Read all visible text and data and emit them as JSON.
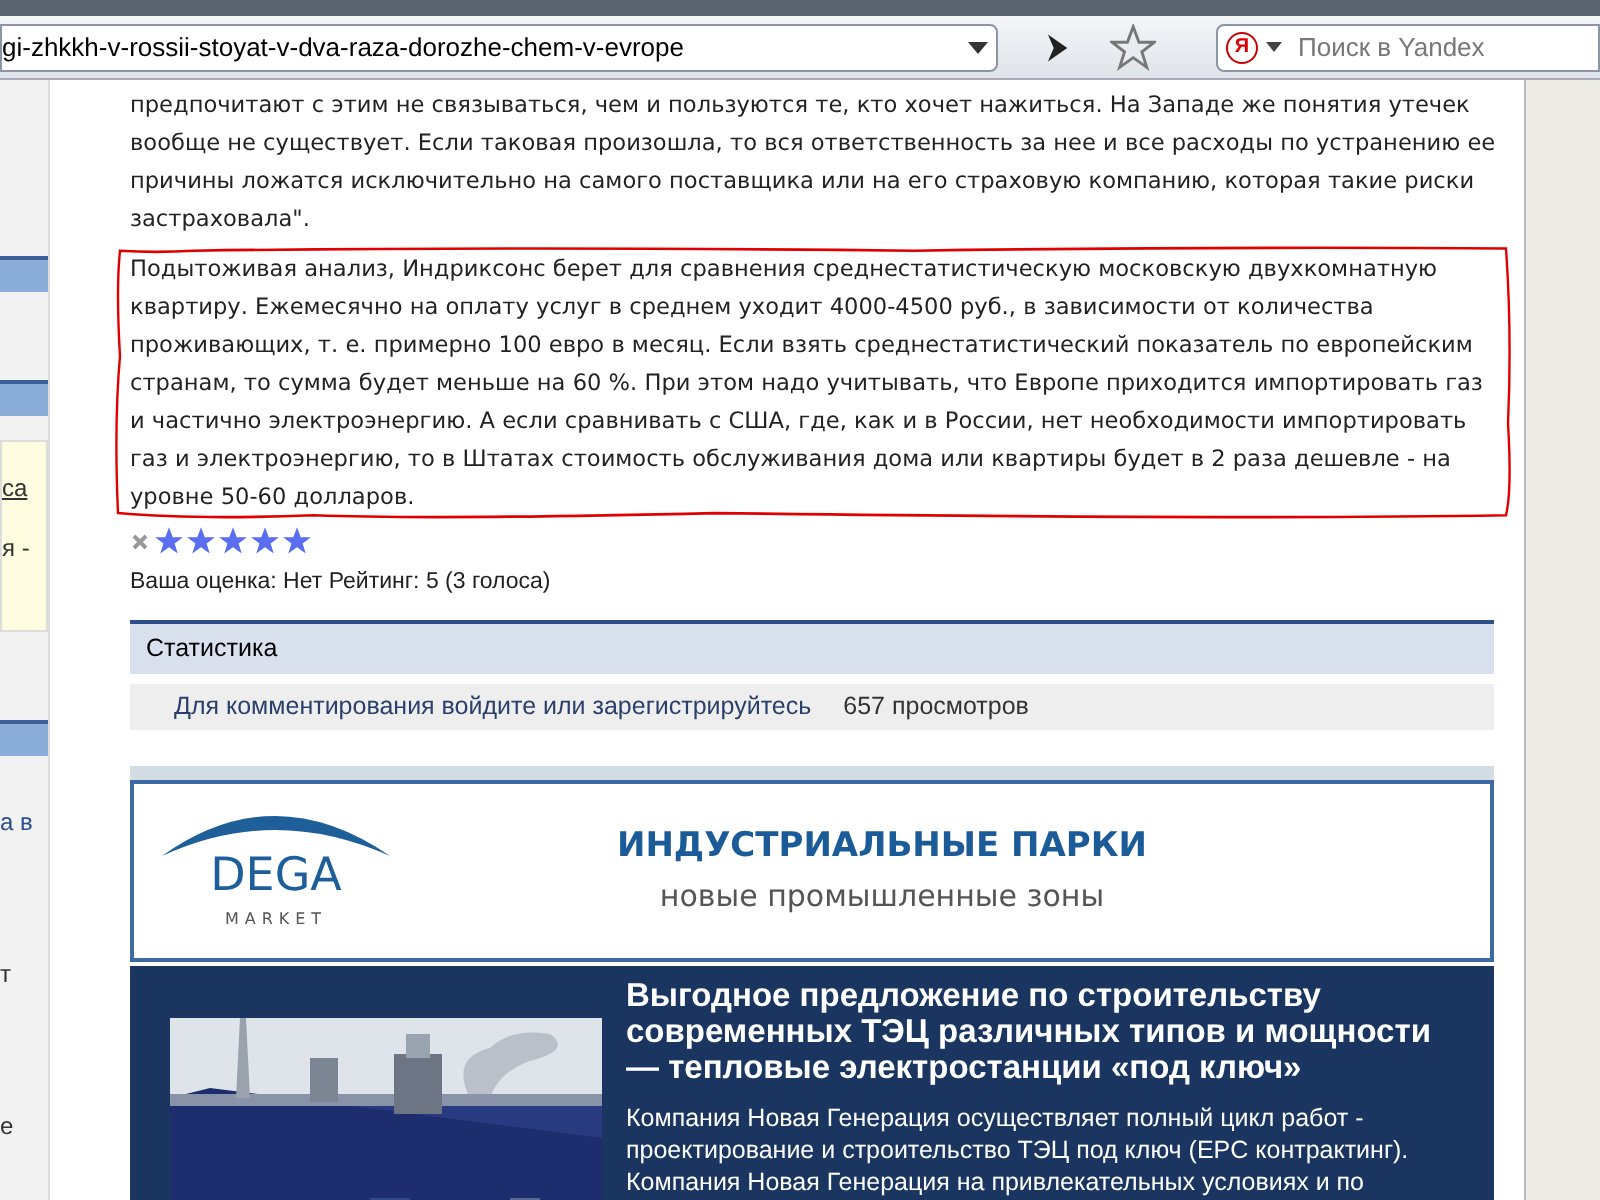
{
  "browser": {
    "url": "gi-zhkkh-v-rossii-stoyat-v-dva-raza-dorozhe-chem-v-evrope",
    "search_placeholder": "Поиск в Yandex",
    "search_engine_letter": "Я"
  },
  "sidebar": [
    {
      "kind": "bar"
    },
    {
      "kind": "bar"
    },
    {
      "kind": "note",
      "lines": [
        {
          "text": "са",
          "link": true
        },
        {
          "text": "я -",
          "link": false
        }
      ]
    },
    {
      "kind": "bar"
    },
    {
      "kind": "text",
      "text": "а в",
      "link": true
    },
    {
      "kind": "text",
      "text": "т",
      "link": false
    },
    {
      "kind": "text",
      "text": "е",
      "link": false
    }
  ],
  "article": {
    "paragraphs": [
      {
        "text": "предпочитают с этим не связываться, чем и пользуются те, кто хочет нажиться. На Западе же понятия утечек вообще не существует. Если таковая произошла, то вся ответственность за нее и все расходы по устранению ее причины ложатся исключительно на самого поставщика или на его страховую компанию, которая такие риски застраховала\".",
        "annotated": false
      },
      {
        "text": "Подытоживая анализ, Индриксонс берет для сравнения среднестатистическую московскую двухкомнатную квартиру. Ежемесячно на оплату услуг в среднем уходит 4000-4500 руб., в зависимости от количества проживающих, т. е. примерно 100 евро в месяц. Если взять среднестатистический показатель по европейским странам, то сумма будет меньше на 60 %. При этом надо учитывать, что Европе приходится импортировать газ и частично электроэнергию. А если сравнивать с США, где, как и в России, нет необходимости импортировать газ и электроэнергию, то в Штатах стоимость обслуживания дома или квартиры будет в 2 раза дешевле - на уровне 50-60 долларов.",
        "annotated": true
      }
    ]
  },
  "rating": {
    "stars": 5,
    "text": "Ваша оценка: Нет Рейтинг: 5 (3 голоса)"
  },
  "statistics": {
    "title": "Статистика",
    "login_link": "Для комментирования войдите или зарегистрируйтесь",
    "views": "657 просмотров"
  },
  "ad_banner": {
    "logo_name": "DEGA",
    "logo_sub": "MARKET",
    "title": "ИНДУСТРИАЛЬНЫЕ ПАРКИ",
    "subtitle": "новые промышленные зоны"
  },
  "promo": {
    "kind": "picture",
    "headline": "Выгодное предложение по строительству современных ТЭЦ различных типов и мощности — тепловые электростанции «под ключ»",
    "body": "Компания Новая Генерация осуществляет полный цикл работ - проектирование и строительство ТЭЦ под ключ (EPC контрактинг). Компания Новая Генерация на привлекательных условиях и по"
  }
}
